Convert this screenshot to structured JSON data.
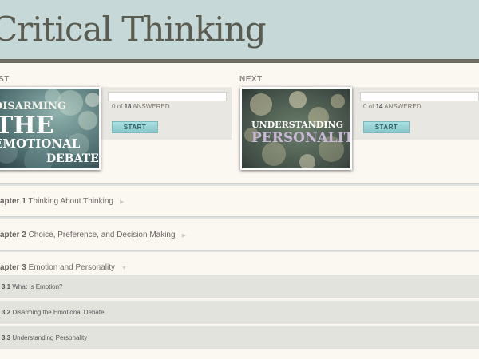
{
  "header": {
    "title": "Critical Thinking"
  },
  "last": {
    "label": "ST",
    "thumb_lines": [
      "DISARMING",
      "THE",
      "EMOTIONAL",
      "DEBATE"
    ],
    "answered_count": "0",
    "answered_middle": " of ",
    "answered_total": "18",
    "answered_suffix": " ANSWERED",
    "start_label": "START"
  },
  "next": {
    "label": "NEXT",
    "thumb_lines": [
      "UNDERSTANDING",
      "PERSONALITY"
    ],
    "answered_count": "0",
    "answered_middle": " of ",
    "answered_total": "14",
    "answered_suffix": " ANSWERED",
    "start_label": "START"
  },
  "chapters": [
    {
      "num": "apter 1",
      "title": " Thinking About Thinking"
    },
    {
      "num": "apter 2",
      "title": " Choice, Preference, and Decision Making"
    },
    {
      "num": "apter 3",
      "title": " Emotion and Personality"
    }
  ],
  "lessons": [
    {
      "num": "3.1",
      "title": " What Is Emotion?"
    },
    {
      "num": "3.2",
      "title": " Disarming the Emotional Debate"
    },
    {
      "num": "3.3",
      "title": " Understanding Personality"
    }
  ],
  "colors": {
    "header_bg": "#c6d8d7",
    "accent": "#86c8cb",
    "page_bg": "#fbf7f1"
  }
}
